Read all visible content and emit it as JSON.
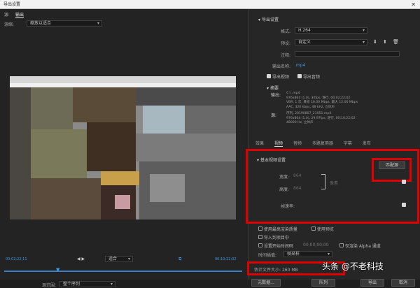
{
  "window": {
    "title": "导出设置",
    "close_glyph": "✕"
  },
  "left_tabs": [
    "源",
    "输出"
  ],
  "source_row": {
    "label": "源缩:",
    "value": "缩放以适合"
  },
  "timeline": {
    "start_time": "00;02;22;11",
    "end_time": "00;10;22;02",
    "fit_value": "适合",
    "range_label": "源范围:",
    "range_value": "整个序列"
  },
  "export_settings": {
    "section_title": "导出设置",
    "format_label": "格式:",
    "format_value": "H.264",
    "preset_label": "预设:",
    "preset_value": "自定义",
    "comment_label": "注释:",
    "output_name_label": "输出名称:",
    "output_name_value": "        .mp4",
    "export_video_label": "导出视频",
    "export_audio_label": "导出音频"
  },
  "summary": {
    "title": "摘要",
    "output_label": "输出:",
    "output_lines": [
      "C:\\                          .mp4",
      "976x864 (1.0), 30fps, 逐行, 00;02;22;02",
      "VBR, 1 次, 目标 16.00 Mbps, 最大 12.00 Mbps",
      "AAC, 320 kbps, 48 kHz, 立体声"
    ],
    "source_label": "源:",
    "source_lines": [
      "序列, 20190807_21051.mp4",
      "976x864 (1.0), 29.97fps, 逐行, 00;10;22;02",
      "48000 Hz, 立体声"
    ]
  },
  "sub_tabs": [
    "效果",
    "视频",
    "音频",
    "多路复用器",
    "字幕",
    "发布"
  ],
  "basic_video": {
    "title": "基本视频设置",
    "match_source_button": "匹配源",
    "width_label": "宽度:",
    "width_value": "864",
    "height_label": "高度:",
    "height_value": "864",
    "unit": "像素",
    "fps_label": "帧速率:"
  },
  "lower_options": {
    "use_max_render": "使用最高渲染质量",
    "use_previews": "使用预览",
    "import_project": "导入到项目中",
    "set_start_timecode": "设置开始时间码",
    "timecode_value": "00;00;00;00",
    "render_alpha": "仅渲染 Alpha 通道",
    "interpolation_label": "时间插值:",
    "interpolation_value": "帧采样",
    "file_size_label": "估计文件大小:",
    "file_size_value": "260 MB"
  },
  "buttons": {
    "metadata": "元数据...",
    "queue": "队列",
    "export": "导出",
    "cancel": "取消"
  },
  "watermark": "头条 @不老科技",
  "colors": {
    "highlight_red": "#e00000",
    "accent_blue": "#3b9be8"
  },
  "icons": [
    "close-icon",
    "save-preset-icon",
    "import-preset-icon",
    "delete-preset-icon",
    "playhead-icon",
    "chevron-down-icon"
  ]
}
